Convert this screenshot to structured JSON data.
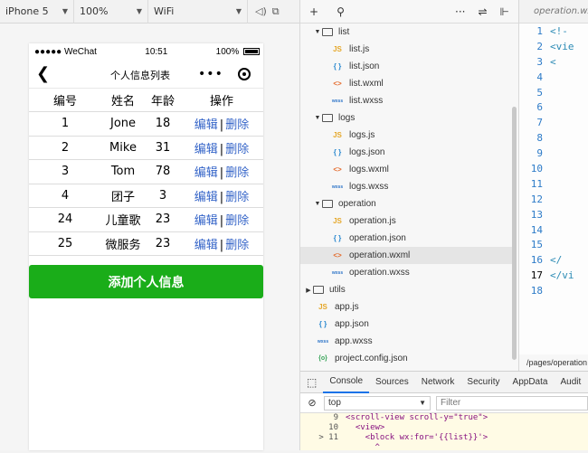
{
  "simulator": {
    "device": "iPhone 5",
    "zoom": "100%",
    "network": "WiFi"
  },
  "phone": {
    "status": {
      "carrier": "●●●●● WeChat",
      "time": "10:51",
      "battery": "100%"
    },
    "nav": {
      "back": "❮",
      "title": "个人信息列表",
      "dots": "•••"
    },
    "table": {
      "headers": [
        "编号",
        "姓名",
        "年龄",
        "操作"
      ],
      "rows": [
        {
          "id": "1",
          "name": "Jone",
          "age": "18"
        },
        {
          "id": "2",
          "name": "Mike",
          "age": "31"
        },
        {
          "id": "3",
          "name": "Tom",
          "age": "78"
        },
        {
          "id": "4",
          "name": "团子",
          "age": "3"
        },
        {
          "id": "24",
          "name": "儿童歌",
          "age": "23"
        },
        {
          "id": "25",
          "name": "微服务",
          "age": "23"
        }
      ],
      "edit_label": "编辑",
      "separator": "|",
      "delete_label": "删除"
    },
    "add_button": "添加个人信息"
  },
  "file_tree": [
    {
      "type": "folder",
      "name": "list",
      "indent": 1,
      "open": true
    },
    {
      "type": "js",
      "name": "list.js",
      "indent": 2
    },
    {
      "type": "json",
      "name": "list.json",
      "indent": 2
    },
    {
      "type": "wxml",
      "name": "list.wxml",
      "indent": 2
    },
    {
      "type": "wxss",
      "name": "list.wxss",
      "indent": 2
    },
    {
      "type": "folder",
      "name": "logs",
      "indent": 1,
      "open": true
    },
    {
      "type": "js",
      "name": "logs.js",
      "indent": 2
    },
    {
      "type": "json",
      "name": "logs.json",
      "indent": 2
    },
    {
      "type": "wxml",
      "name": "logs.wxml",
      "indent": 2
    },
    {
      "type": "wxss",
      "name": "logs.wxss",
      "indent": 2
    },
    {
      "type": "folder",
      "name": "operation",
      "indent": 1,
      "open": true
    },
    {
      "type": "js",
      "name": "operation.js",
      "indent": 2
    },
    {
      "type": "json",
      "name": "operation.json",
      "indent": 2
    },
    {
      "type": "wxml",
      "name": "operation.wxml",
      "indent": 2,
      "selected": true
    },
    {
      "type": "wxss",
      "name": "operation.wxss",
      "indent": 2
    },
    {
      "type": "folder",
      "name": "utils",
      "indent": 0,
      "open": false
    },
    {
      "type": "js",
      "name": "app.js",
      "indent": 0
    },
    {
      "type": "json",
      "name": "app.json",
      "indent": 0
    },
    {
      "type": "wxss",
      "name": "app.wxss",
      "indent": 0
    },
    {
      "type": "cfg",
      "name": "project.config.json",
      "indent": 0
    }
  ],
  "editor": {
    "tab": "operation.wxml",
    "active_line": 17,
    "lines": [
      {
        "n": "1",
        "code": "<!-"
      },
      {
        "n": "2",
        "code": "<vie"
      },
      {
        "n": "3",
        "code": "  <"
      },
      {
        "n": "4",
        "code": ""
      },
      {
        "n": "5",
        "code": ""
      },
      {
        "n": "6",
        "code": ""
      },
      {
        "n": "7",
        "code": ""
      },
      {
        "n": "8",
        "code": ""
      },
      {
        "n": "9",
        "code": ""
      },
      {
        "n": "10",
        "code": ""
      },
      {
        "n": "11",
        "code": ""
      },
      {
        "n": "12",
        "code": ""
      },
      {
        "n": "13",
        "code": ""
      },
      {
        "n": "14",
        "code": ""
      },
      {
        "n": "15",
        "code": ""
      },
      {
        "n": "16",
        "code": "  </"
      },
      {
        "n": "17",
        "code": "</vi"
      },
      {
        "n": "18",
        "code": ""
      }
    ],
    "path": "/pages/operation"
  },
  "devtools": {
    "tabs": [
      "Console",
      "Sources",
      "Network",
      "Security",
      "AppData",
      "Audit"
    ],
    "active_tab": "Console",
    "context": "top",
    "filter_placeholder": "Filter",
    "console_lines": [
      {
        "n": "9",
        "text": "<scroll-view scroll-y=\"true\">"
      },
      {
        "n": "10",
        "text": "  <view>"
      },
      {
        "n": "> 11",
        "text": "    <block wx:for='{{list}}'>"
      },
      {
        "n": "",
        "text": "      ^"
      }
    ]
  },
  "colors": {
    "accent_green": "#1aad19",
    "link_blue": "#3464c8"
  }
}
